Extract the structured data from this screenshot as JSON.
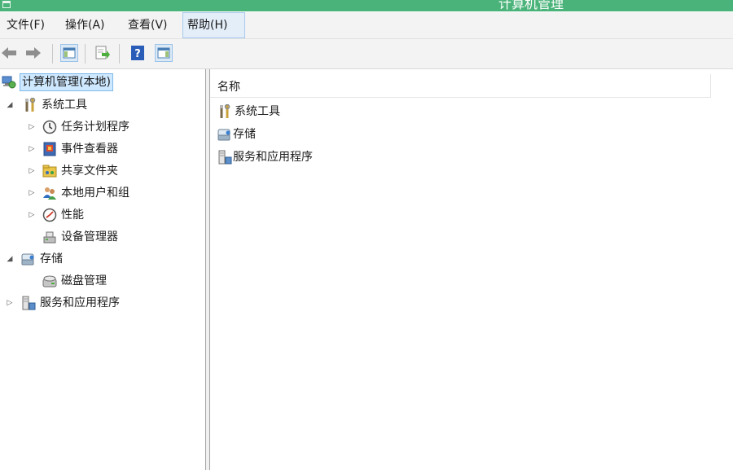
{
  "window": {
    "title": "计算机管理"
  },
  "menu": {
    "items": [
      {
        "label": "文件(F)"
      },
      {
        "label": "操作(A)"
      },
      {
        "label": "查看(V)"
      },
      {
        "label": "帮助(H)"
      }
    ],
    "active_index": 3
  },
  "toolbar": {
    "buttons": [
      "back-icon",
      "forward-icon",
      "show-hide-tree-icon",
      "export-list-icon",
      "help-icon",
      "show-hide-action-pane-icon"
    ]
  },
  "tree": {
    "items": [
      {
        "label": "计算机管理(本地)",
        "icon": "computer-management-icon",
        "selected": true
      },
      {
        "label": "系统工具",
        "icon": "system-tools-icon",
        "expanded": true
      },
      {
        "label": "任务计划程序",
        "icon": "task-scheduler-icon"
      },
      {
        "label": "事件查看器",
        "icon": "event-viewer-icon"
      },
      {
        "label": "共享文件夹",
        "icon": "shared-folders-icon"
      },
      {
        "label": "本地用户和组",
        "icon": "local-users-groups-icon"
      },
      {
        "label": "性能",
        "icon": "performance-icon"
      },
      {
        "label": "设备管理器",
        "icon": "device-manager-icon"
      },
      {
        "label": "存储",
        "icon": "storage-icon",
        "expanded": true
      },
      {
        "label": "磁盘管理",
        "icon": "disk-management-icon"
      },
      {
        "label": "服务和应用程序",
        "icon": "services-applications-icon"
      }
    ]
  },
  "list": {
    "column_header": "名称",
    "items": [
      {
        "label": "系统工具",
        "icon": "system-tools-icon"
      },
      {
        "label": "存储",
        "icon": "storage-icon"
      },
      {
        "label": "服务和应用程序",
        "icon": "services-applications-icon"
      }
    ]
  },
  "colors": {
    "title_bar": "#4ab37a",
    "selection": "#cde8ff",
    "menu_active": "#e3eef9"
  }
}
